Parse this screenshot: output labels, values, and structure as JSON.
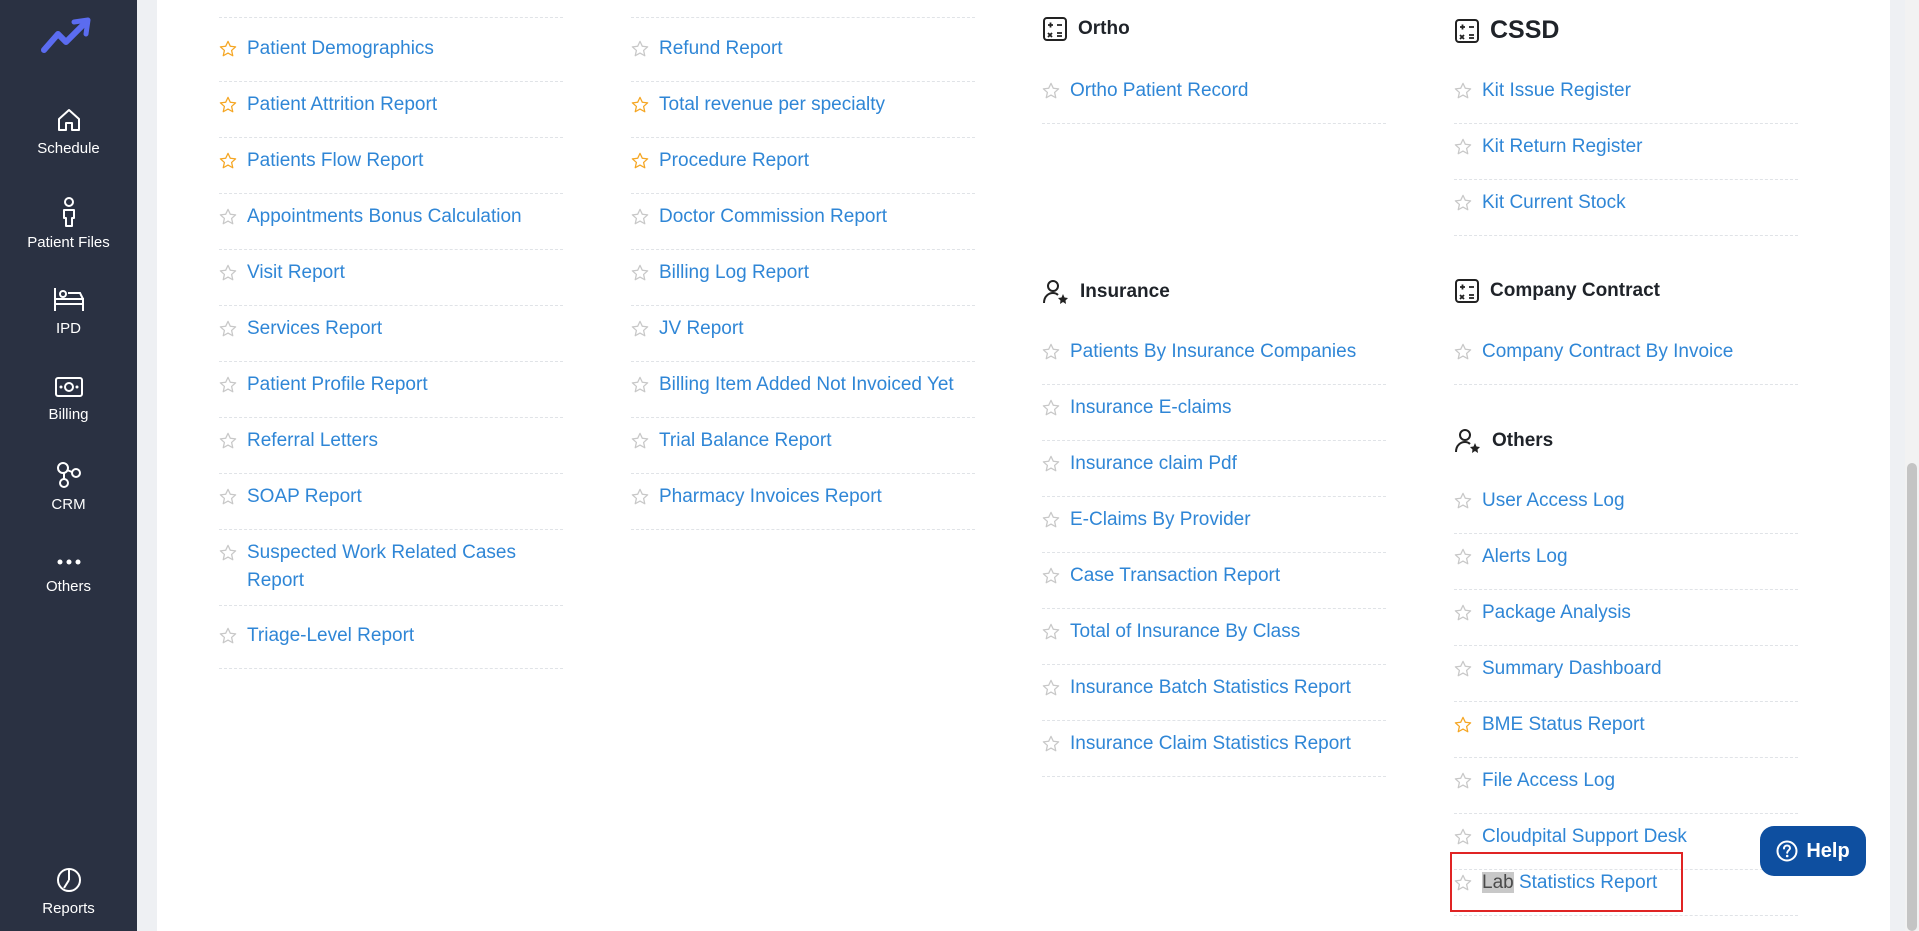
{
  "colors": {
    "sidebar_bg": "#2a3142",
    "link": "#2f86d6",
    "star_active": "#f5a623",
    "star_inactive": "#c8c8c8",
    "help_bg": "#0e4fa0",
    "highlight_box": "#e02424"
  },
  "sidebar": {
    "items": [
      {
        "label": "Schedule",
        "icon": "home-icon"
      },
      {
        "label": "Patient Files",
        "icon": "person-icon"
      },
      {
        "label": "IPD",
        "icon": "bed-icon"
      },
      {
        "label": "Billing",
        "icon": "money-icon"
      },
      {
        "label": "CRM",
        "icon": "network-icon"
      },
      {
        "label": "Others",
        "icon": "more-icon"
      },
      {
        "label": "Reports",
        "icon": "pie-chart-icon"
      }
    ]
  },
  "columns": {
    "col1": {
      "items": [
        {
          "label": "Patient Demographics",
          "starred": true
        },
        {
          "label": "Patient Attrition Report",
          "starred": true
        },
        {
          "label": "Patients Flow Report",
          "starred": true
        },
        {
          "label": "Appointments Bonus Calculation",
          "starred": false
        },
        {
          "label": "Visit Report",
          "starred": false
        },
        {
          "label": "Services Report",
          "starred": false
        },
        {
          "label": "Patient Profile Report",
          "starred": false
        },
        {
          "label": "Referral Letters",
          "starred": false
        },
        {
          "label": "SOAP Report",
          "starred": false
        },
        {
          "label": "Suspected Work Related Cases Report",
          "starred": false
        },
        {
          "label": "Triage-Level Report",
          "starred": false
        }
      ]
    },
    "col2": {
      "items": [
        {
          "label": "Refund Report",
          "starred": false
        },
        {
          "label": "Total revenue per specialty",
          "starred": true
        },
        {
          "label": "Procedure Report",
          "starred": true
        },
        {
          "label": "Doctor Commission Report",
          "starred": false
        },
        {
          "label": "Billing Log Report",
          "starred": false
        },
        {
          "label": "JV Report",
          "starred": false
        },
        {
          "label": "Billing Item Added Not Invoiced Yet",
          "starred": false
        },
        {
          "label": "Trial Balance Report",
          "starred": false
        },
        {
          "label": "Pharmacy Invoices Report",
          "starred": false
        }
      ]
    },
    "ortho": {
      "title": "Ortho",
      "items": [
        {
          "label": "Ortho Patient Record",
          "starred": false
        }
      ]
    },
    "insurance": {
      "title": "Insurance",
      "items": [
        {
          "label": "Patients By Insurance Companies",
          "starred": false
        },
        {
          "label": "Insurance E-claims",
          "starred": false
        },
        {
          "label": "Insurance claim Pdf",
          "starred": false
        },
        {
          "label": "E-Claims By Provider",
          "starred": false
        },
        {
          "label": "Case Transaction Report",
          "starred": false
        },
        {
          "label": "Total of Insurance By Class",
          "starred": false
        },
        {
          "label": "Insurance Batch Statistics Report",
          "starred": false
        },
        {
          "label": "Insurance Claim Statistics Report",
          "starred": false
        }
      ]
    },
    "cssd": {
      "title": "CSSD",
      "items": [
        {
          "label": "Kit Issue Register",
          "starred": false
        },
        {
          "label": "Kit Return Register",
          "starred": false
        },
        {
          "label": "Kit Current Stock",
          "starred": false
        }
      ]
    },
    "company_contract": {
      "title": "Company Contract",
      "items": [
        {
          "label": "Company Contract By Invoice",
          "starred": false
        }
      ]
    },
    "others": {
      "title": "Others",
      "items": [
        {
          "label": "User Access Log",
          "starred": false
        },
        {
          "label": "Alerts Log",
          "starred": false
        },
        {
          "label": "Package Analysis",
          "starred": false
        },
        {
          "label": "Summary Dashboard",
          "starred": false
        },
        {
          "label": "BME Status Report",
          "starred": true
        },
        {
          "label": "File Access Log",
          "starred": false
        },
        {
          "label": "Cloudpital Support Desk",
          "starred": false
        }
      ],
      "last_item": {
        "highlight": "Lab",
        "rest": " Statistics Report",
        "starred": false
      }
    }
  },
  "help": {
    "label": "Help",
    "icon": "question-circle-icon"
  }
}
